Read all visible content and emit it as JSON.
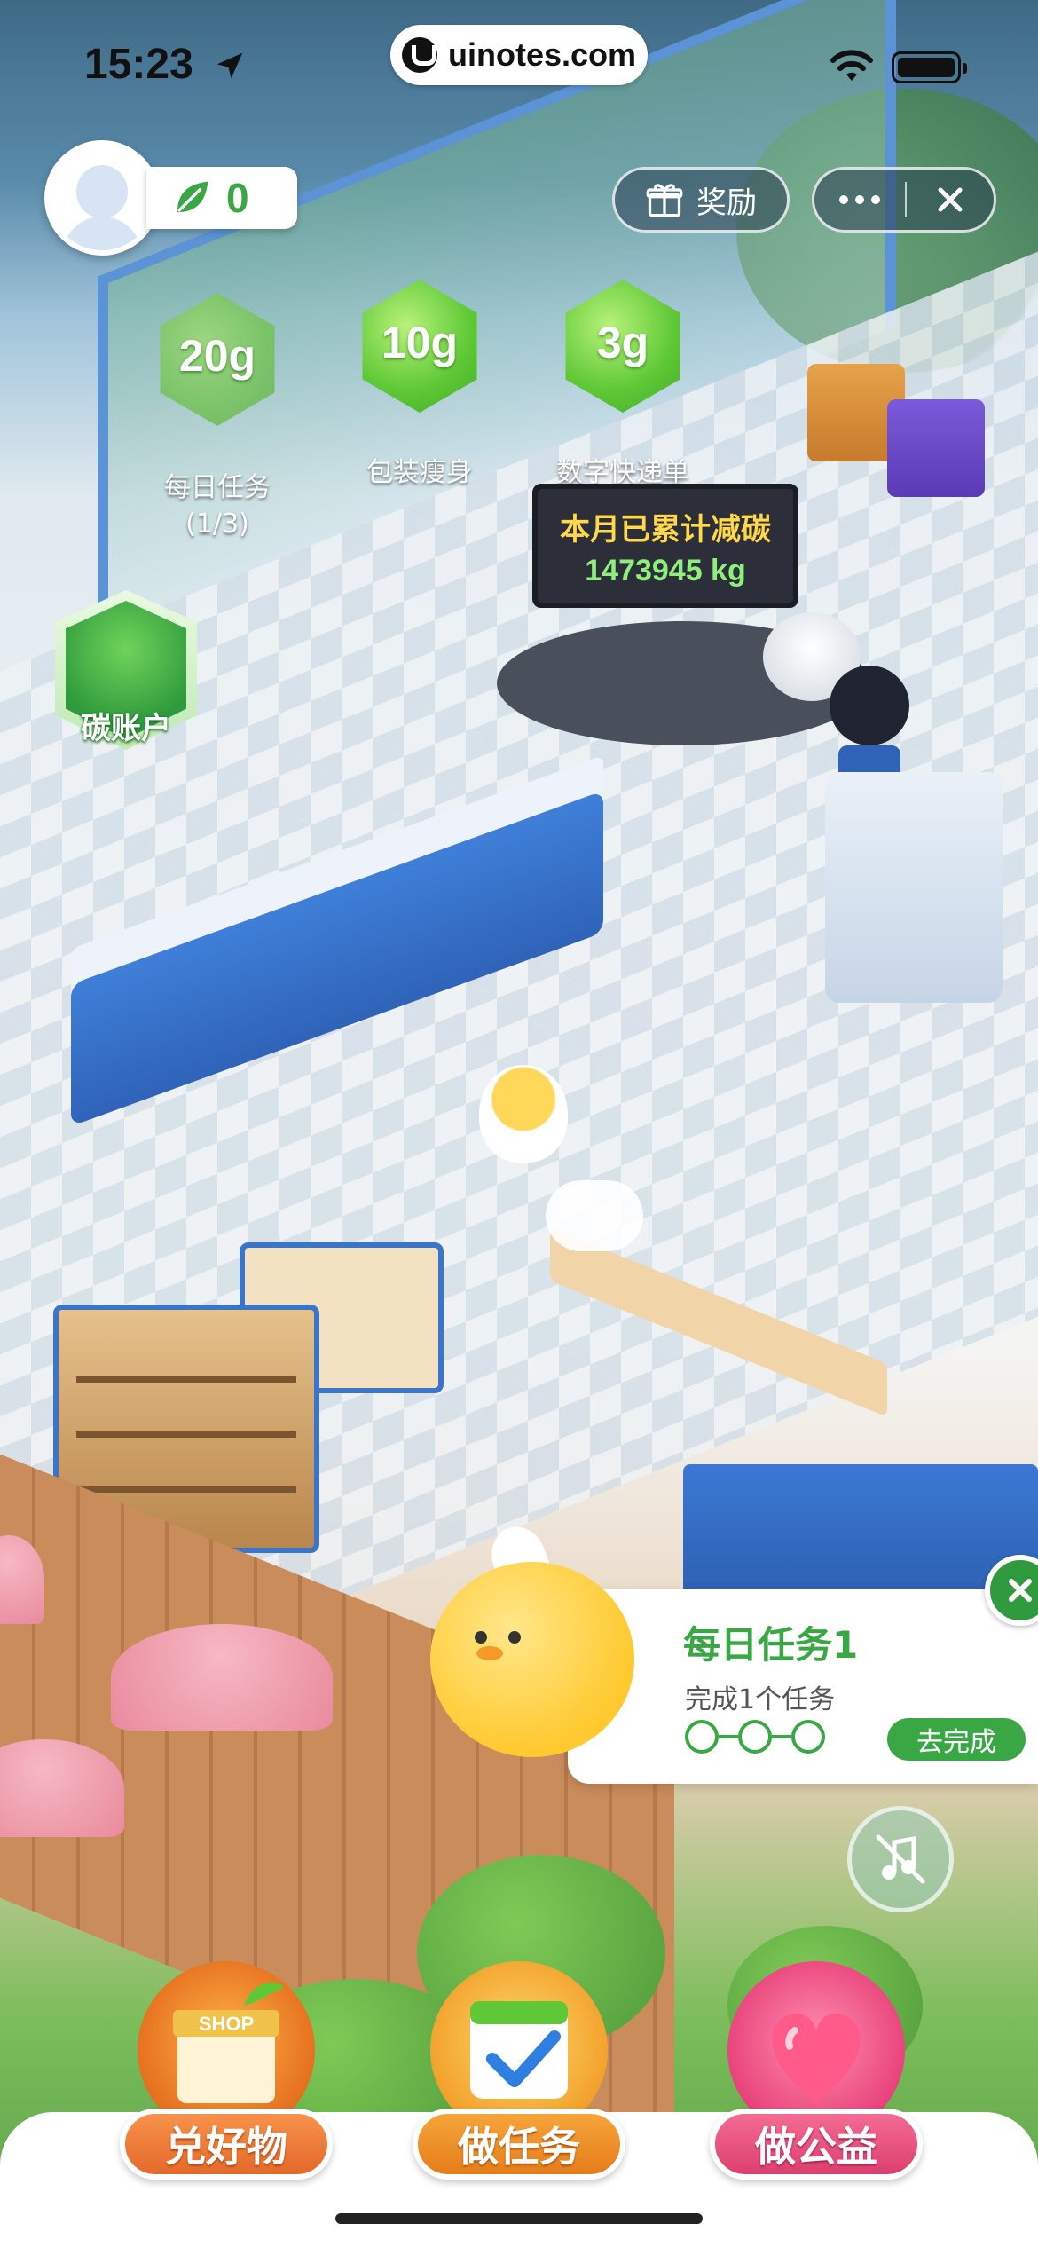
{
  "status_bar": {
    "time": "15:23",
    "url": "uinotes.com"
  },
  "hud": {
    "leaf_count": "0",
    "reward_label": "奖励"
  },
  "bubbles": [
    {
      "amount": "20g",
      "label": "每日任务",
      "sublabel": "(1/3)"
    },
    {
      "amount": "10g",
      "label": "包装瘦身"
    },
    {
      "amount": "3g",
      "label": "数字快递单"
    }
  ],
  "board": {
    "title": "本月已累计减碳",
    "value": "1473945 kg"
  },
  "carbon_account": {
    "label": "碳账户"
  },
  "task_card": {
    "title": "每日任务1",
    "subtitle": "完成1个任务",
    "progress_total": 3,
    "progress_done": 0,
    "action_label": "去完成"
  },
  "scene": {
    "shop_sign": "SHOP"
  },
  "bottom_nav": [
    {
      "label": "兑好物"
    },
    {
      "label": "做任务"
    },
    {
      "label": "做公益"
    }
  ],
  "colors": {
    "brand_green": "#3aa745",
    "shop_orange": "#e4692a",
    "task_orange": "#e57d1a",
    "charity_pink": "#dc3f6f"
  }
}
